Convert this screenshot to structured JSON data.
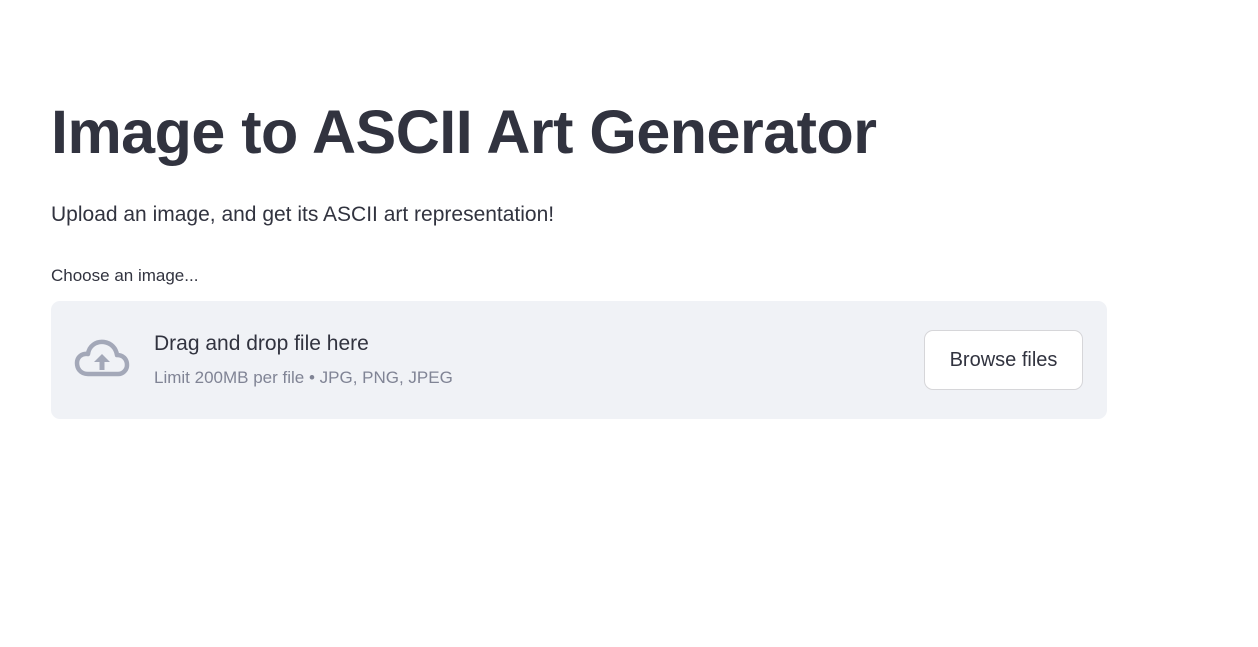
{
  "page": {
    "title": "Image to ASCII Art Generator",
    "subtitle": "Upload an image, and get its ASCII art representation!"
  },
  "uploader": {
    "label": "Choose an image...",
    "drop_text": "Drag and drop file here",
    "limit_text": "Limit 200MB per file • JPG, PNG, JPEG",
    "browse_label": "Browse files",
    "icon": "cloud-upload-icon"
  },
  "colors": {
    "text": "#31333f",
    "muted": "#808495",
    "dropzone_bg": "#f0f2f6",
    "icon": "#a3a8b8"
  }
}
